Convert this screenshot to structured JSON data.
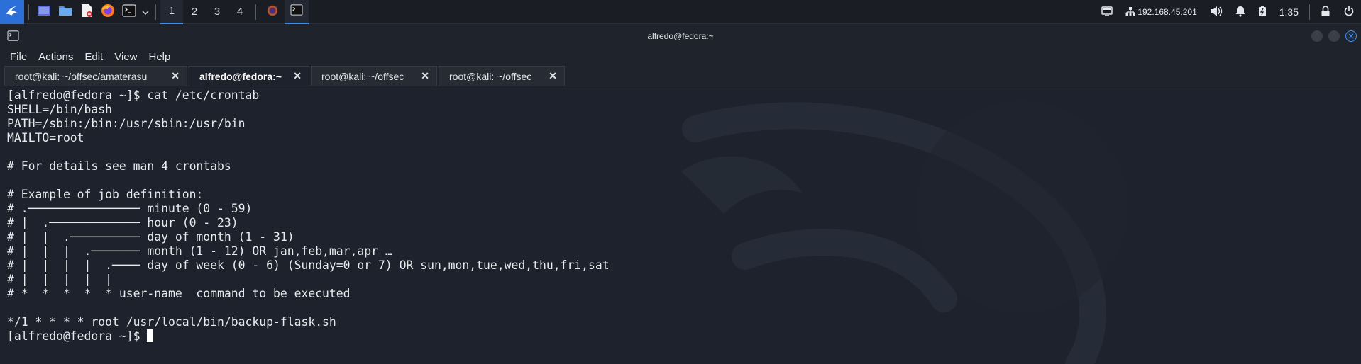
{
  "panel": {
    "workspaces": [
      "1",
      "2",
      "3",
      "4"
    ],
    "active_workspace": "1",
    "ip_address": "192.168.45.201",
    "clock": "1:35"
  },
  "window": {
    "title": "alfredo@fedora:~"
  },
  "menu": {
    "file": "File",
    "actions": "Actions",
    "edit": "Edit",
    "view": "View",
    "help": "Help"
  },
  "tabs": [
    {
      "label": "root@kali: ~/offsec/amaterasu",
      "active": false
    },
    {
      "label": "alfredo@fedora:~",
      "active": true
    },
    {
      "label": "root@kali: ~/offsec",
      "active": false
    },
    {
      "label": "root@kali: ~/offsec",
      "active": false
    }
  ],
  "terminal": {
    "lines": [
      "[alfredo@fedora ~]$ cat /etc/crontab",
      "SHELL=/bin/bash",
      "PATH=/sbin:/bin:/usr/sbin:/usr/bin",
      "MAILTO=root",
      "",
      "# For details see man 4 crontabs",
      "",
      "# Example of job definition:",
      "# .──────────────── minute (0 - 59)",
      "# |  .───────────── hour (0 - 23)",
      "# |  |  .────────── day of month (1 - 31)",
      "# |  |  |  .─────── month (1 - 12) OR jan,feb,mar,apr …",
      "# |  |  |  |  .──── day of week (0 - 6) (Sunday=0 or 7) OR sun,mon,tue,wed,thu,fri,sat",
      "# |  |  |  |  |",
      "# *  *  *  *  * user-name  command to be executed",
      "",
      "*/1 * * * * root /usr/local/bin/backup-flask.sh"
    ],
    "prompt": "[alfredo@fedora ~]$ "
  },
  "colors": {
    "accent": "#3a8ef0",
    "terminal_bg": "#1d222c",
    "panel_bg": "#1a1d24",
    "text": "#e8eaed"
  },
  "icons": {
    "menu": "kali-dragon-icon",
    "launchers": [
      "workspace-switcher-icon",
      "file-manager-icon",
      "text-editor-icon",
      "firefox-icon",
      "terminal-icon",
      "chevron-down-icon"
    ],
    "tray": [
      "display-icon",
      "network-icon",
      "volume-icon",
      "notification-bell-icon",
      "battery-icon",
      "lock-icon",
      "power-icon"
    ]
  }
}
